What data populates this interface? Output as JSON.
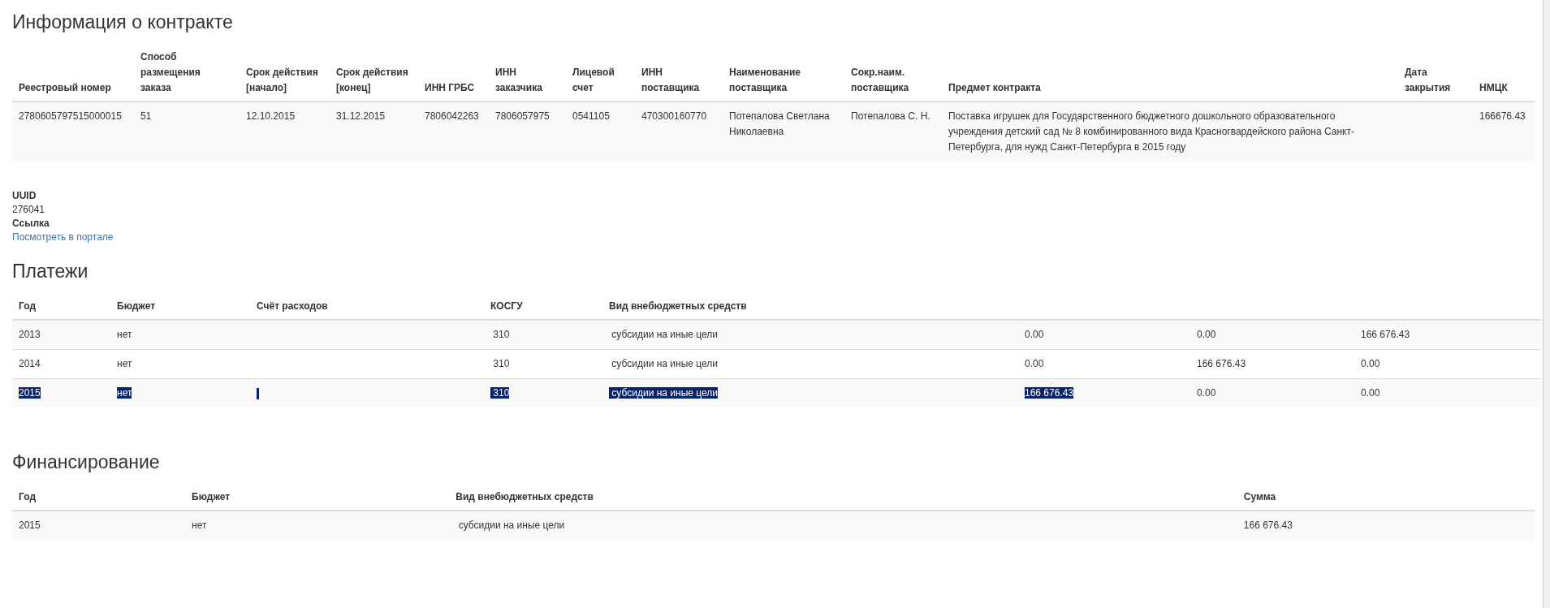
{
  "contract": {
    "title": "Информация о контракте",
    "columns": [
      "Реестровый номер",
      "Способ размещения заказа",
      "Срок действия [начало]",
      "Срок действия [конец]",
      "ИНН ГРБС",
      "ИНН заказчика",
      "Лицевой счет",
      "ИНН поставщика",
      "Наименование поставщика",
      "Сокр.наим. поставщика",
      "Предмет контракта",
      "Дата закрытия",
      "НМЦК"
    ],
    "rows": [
      [
        "2780605797515000015",
        "51",
        "12.10.2015",
        "31.12.2015",
        "7806042263",
        "7806057975",
        "0541105",
        "470300160770",
        "Потепалова Светлана Николаевна",
        "Потепалова С. Н.",
        "Поставка игрушек для Государственного бюджетного дошкольного образовательного учреждения детский сад № 8 комбинированного вида Красногвардейского района Санкт-Петербурга, для нужд Санкт-Петербурга в 2015 году",
        "",
        "166676.43"
      ]
    ]
  },
  "details": [
    {
      "label": "UUID",
      "value": "276041",
      "kind": "text"
    },
    {
      "label": "Ссылка",
      "value": "Посмотреть в портале",
      "kind": "link"
    }
  ],
  "payments": {
    "title": "Платежи",
    "columns": [
      "Год",
      "Бюджет",
      "Счёт расходов",
      "КОСГУ",
      "Вид внебюджетных средств",
      "",
      "",
      ""
    ],
    "rows": [
      {
        "cells": [
          {
            "text": "2013",
            "selected": false
          },
          {
            "text": "нет",
            "selected": false
          },
          {
            "text": "",
            "selected": false
          },
          {
            "text": " 310",
            "selected": false
          },
          {
            "text": " субсидии на иные цели",
            "selected": false
          },
          {
            "text": "0.00",
            "selected": false
          },
          {
            "text": "0.00",
            "selected": false
          },
          {
            "text": "166 676.43",
            "selected": false
          }
        ]
      },
      {
        "cells": [
          {
            "text": "2014",
            "selected": false
          },
          {
            "text": "нет",
            "selected": false
          },
          {
            "text": "",
            "selected": false
          },
          {
            "text": " 310",
            "selected": false
          },
          {
            "text": " субсидии на иные цели",
            "selected": false
          },
          {
            "text": "0.00",
            "selected": false
          },
          {
            "text": "166 676.43",
            "selected": false
          },
          {
            "text": "0.00",
            "selected": false
          }
        ]
      },
      {
        "cells": [
          {
            "text": "2015",
            "selected": true
          },
          {
            "text": "нет",
            "selected": true
          },
          {
            "text": "",
            "selected": true
          },
          {
            "text": " 310",
            "selected": true
          },
          {
            "text": " субсидии на иные цели",
            "selected": true
          },
          {
            "text": "166 676.43",
            "selected": true
          },
          {
            "text": "0.00",
            "selected": false
          },
          {
            "text": "0.00",
            "selected": false
          }
        ]
      }
    ]
  },
  "financing": {
    "title": "Финансирование",
    "columns": [
      "Год",
      "Бюджет",
      "Вид внебюджетных средств",
      "Сумма"
    ],
    "rows": [
      [
        "2015",
        "нет",
        " субсидии на иные цели",
        "166 676.43"
      ]
    ]
  }
}
